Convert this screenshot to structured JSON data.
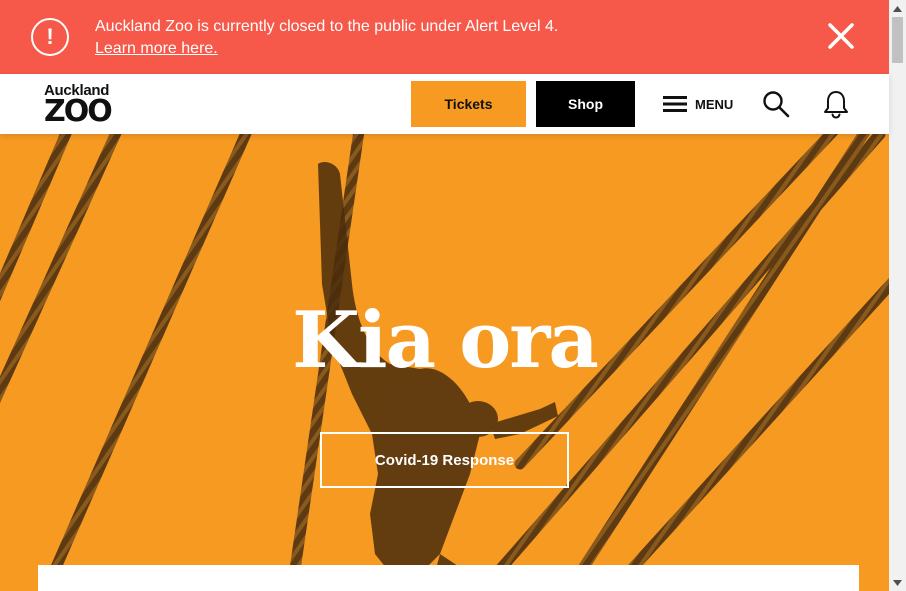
{
  "alert": {
    "icon": "exclamation-circle-icon",
    "message": "Auckland Zoo is currently closed to the public under Alert Level 4.",
    "link_text": "Learn more here.",
    "close_icon": "close-icon",
    "color": "#f6594a"
  },
  "header": {
    "logo_top": "Auckland",
    "logo_bottom": "ZOO",
    "tickets_label": "Tickets",
    "shop_label": "Shop",
    "menu_label": "MENU",
    "menu_icon": "hamburger-icon",
    "search_icon": "search-icon",
    "notifications_icon": "bell-icon",
    "tickets_color": "#f69a21",
    "shop_color": "#000000"
  },
  "hero": {
    "title": "Kia ora",
    "button_label": "Covid-19 Response",
    "background_color": "#f69a21"
  }
}
